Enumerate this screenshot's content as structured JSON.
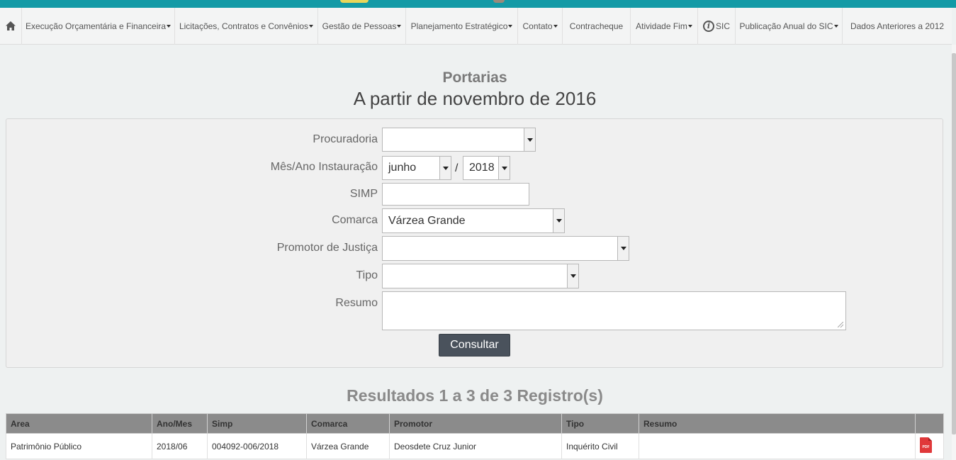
{
  "nav": {
    "home_icon": "home-icon",
    "items": [
      {
        "label": "Execução Orçamentária e Financeira",
        "dropdown": true
      },
      {
        "label": "Licitações, Contratos e Convênios",
        "dropdown": true
      },
      {
        "label": "Gestão de Pessoas",
        "dropdown": true
      },
      {
        "label": "Planejamento Estratégico",
        "dropdown": true
      },
      {
        "label": "Contato",
        "dropdown": true
      },
      {
        "label": "Contracheque",
        "dropdown": false
      },
      {
        "label": "Atividade Fim",
        "dropdown": true
      },
      {
        "label": "SIC",
        "dropdown": false,
        "icon": "info-icon"
      },
      {
        "label": "Publicação Anual do SIC",
        "dropdown": true
      },
      {
        "label": "Dados Anteriores a 2012",
        "dropdown": false
      }
    ]
  },
  "page": {
    "title": "Portarias",
    "subtitle": "A partir de novembro de 2016"
  },
  "form": {
    "procuradoria": {
      "label": "Procuradoria",
      "value": ""
    },
    "mes_ano": {
      "label": "Mês/Ano Instauração",
      "month": "junho",
      "separator": "/",
      "year": "2018"
    },
    "simp": {
      "label": "SIMP",
      "value": ""
    },
    "comarca": {
      "label": "Comarca",
      "value": "Várzea Grande"
    },
    "promotor": {
      "label": "Promotor de Justiça",
      "value": ""
    },
    "tipo": {
      "label": "Tipo",
      "value": ""
    },
    "resumo": {
      "label": "Resumo",
      "value": ""
    },
    "submit_label": "Consultar"
  },
  "results": {
    "title": "Resultados 1 a 3 de 3 Registro(s)",
    "columns": [
      "Area",
      "Ano/Mes",
      "Simp",
      "Comarca",
      "Promotor",
      "Tipo",
      "Resumo",
      ""
    ],
    "rows": [
      {
        "area": "Patrimônio Público",
        "ano_mes": "2018/06",
        "simp": "004092-006/2018",
        "comarca": "Várzea Grande",
        "promotor": "Deosdete Cruz Junior",
        "tipo": "Inquérito Civil",
        "resumo": "",
        "file_icon": "pdf-icon",
        "file_label": "PDF"
      }
    ]
  },
  "colors": {
    "top_bar": "#139aa6",
    "button": "#4a525c",
    "table_header": "#8b8b8b"
  }
}
